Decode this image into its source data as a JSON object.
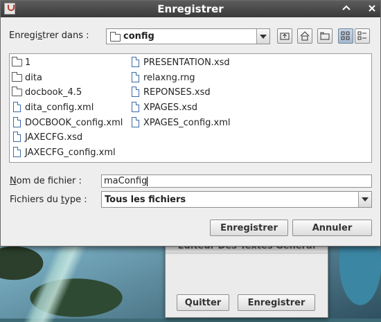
{
  "dialog": {
    "title": "Enregistrer",
    "save_in_label_pre": "Enregi",
    "save_in_label_mn": "s",
    "save_in_label_post": "trer dans :",
    "current_folder": "config",
    "files": [
      {
        "name": "1",
        "kind": "folder"
      },
      {
        "name": "dita",
        "kind": "folder"
      },
      {
        "name": "docbook_4.5",
        "kind": "folder"
      },
      {
        "name": "dita_config.xml",
        "kind": "file"
      },
      {
        "name": "DOCBOOK_config.xml",
        "kind": "file"
      },
      {
        "name": "JAXECFG.xsd",
        "kind": "file"
      },
      {
        "name": "JAXECFG_config.xml",
        "kind": "file"
      },
      {
        "name": "PRESENTATION.xsd",
        "kind": "file"
      },
      {
        "name": "relaxng.rng",
        "kind": "file"
      },
      {
        "name": "REPONSES.xsd",
        "kind": "file"
      },
      {
        "name": "XPAGES.xsd",
        "kind": "file"
      },
      {
        "name": "XPAGES_config.xml",
        "kind": "file"
      }
    ],
    "filename_label_mn": "N",
    "filename_label_post": "om de fichier :",
    "filename_value": "maConfig",
    "filetype_label_pre": "Fichiers du ",
    "filetype_label_mn": "t",
    "filetype_label_post": "ype :",
    "filetype_value": "Tous les fichiers",
    "save_button": "Enregistrer",
    "cancel_button": "Annuler"
  },
  "background_window": {
    "title": "Editeur Des Textes Général",
    "quit_button": "Quitter",
    "save_button": "Enregistrer"
  },
  "colors": {
    "titlebar": "#3a3a3a",
    "dialog_bg": "#eeeeee",
    "active_tool": "#a7b9cf"
  }
}
